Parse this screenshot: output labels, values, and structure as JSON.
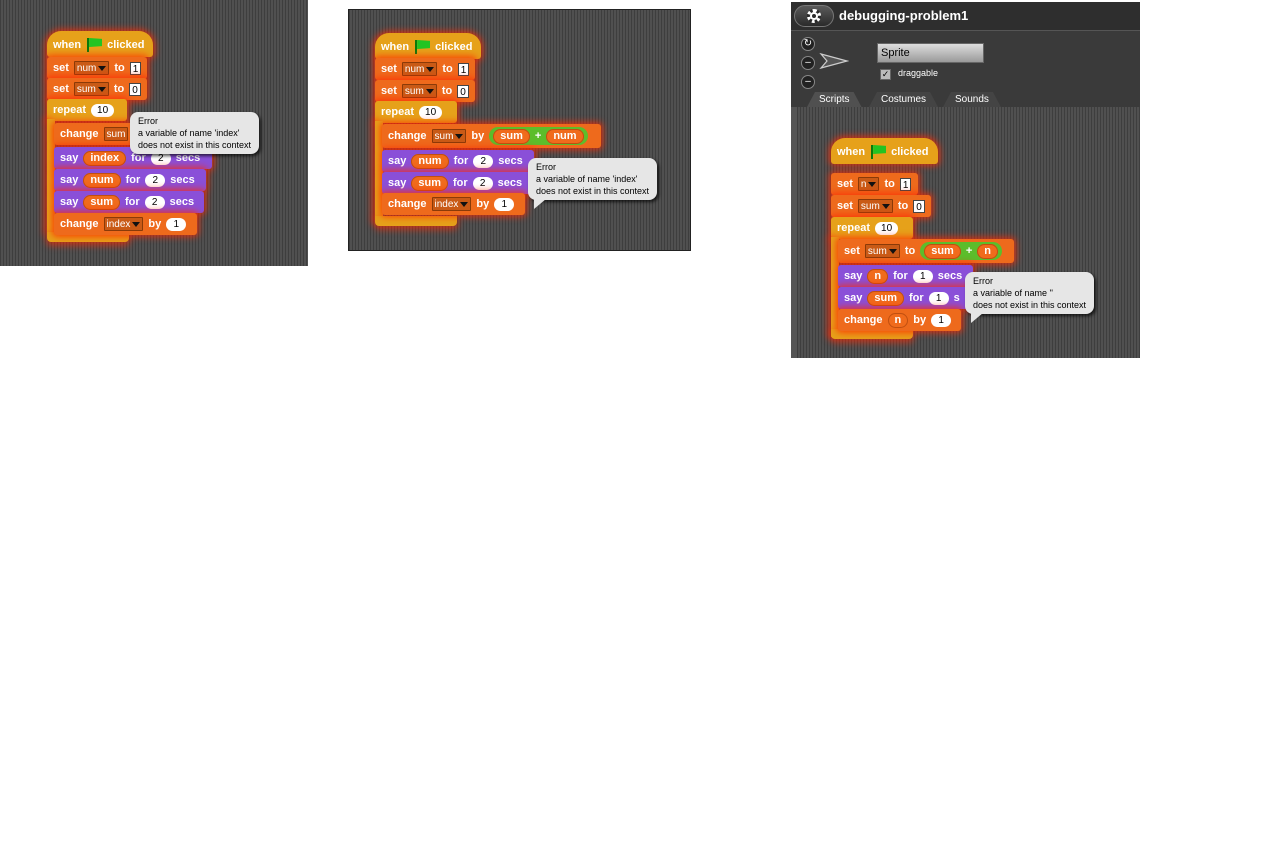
{
  "panel1": {
    "hat": {
      "when": "when",
      "clicked": "clicked"
    },
    "set1": {
      "label": "set",
      "var": "num",
      "to": "to",
      "value": "1"
    },
    "set2": {
      "label": "set",
      "var": "sum",
      "to": "to",
      "value": "0"
    },
    "repeat": {
      "label": "repeat",
      "count": "10"
    },
    "change1": {
      "label": "change",
      "var": "sum"
    },
    "say1": {
      "label": "say",
      "arg": "index",
      "for": "for",
      "secs_value": "2",
      "secs": "secs"
    },
    "say2": {
      "label": "say",
      "arg": "num",
      "for": "for",
      "secs_value": "2",
      "secs": "secs"
    },
    "say3": {
      "label": "say",
      "arg": "sum",
      "for": "for",
      "secs_value": "2",
      "secs": "secs"
    },
    "change2": {
      "label": "change",
      "var": "index",
      "by": "by",
      "value": "1"
    },
    "error": {
      "line1": "Error",
      "line2": "a variable of name 'index'",
      "line3": "does not exist in this context"
    }
  },
  "panel2": {
    "hat": {
      "when": "when",
      "clicked": "clicked"
    },
    "set1": {
      "label": "set",
      "var": "num",
      "to": "to",
      "value": "1"
    },
    "set2": {
      "label": "set",
      "var": "sum",
      "to": "to",
      "value": "0"
    },
    "repeat": {
      "label": "repeat",
      "count": "10"
    },
    "change1": {
      "label": "change",
      "var": "sum",
      "by": "by",
      "op_left": "sum",
      "op": "+",
      "op_right": "num"
    },
    "say1": {
      "label": "say",
      "arg": "num",
      "for": "for",
      "secs_value": "2",
      "secs": "secs"
    },
    "say2": {
      "label": "say",
      "arg": "sum",
      "for": "for",
      "secs_value": "2",
      "secs": "secs"
    },
    "change2": {
      "label": "change",
      "var": "index",
      "by": "by",
      "value": "1"
    },
    "error": {
      "line1": "Error",
      "line2": "a variable of name 'index'",
      "line3": "does not exist in this context"
    }
  },
  "panel3": {
    "title": "debugging-problem1",
    "sprite_name": "Sprite",
    "draggable_label": "draggable",
    "checkmark": "✓",
    "tabs": [
      "Scripts",
      "Costumes",
      "Sounds"
    ],
    "hat": {
      "when": "when",
      "clicked": "clicked"
    },
    "set1": {
      "label": "set",
      "var": "n",
      "to": "to",
      "value": "1"
    },
    "set2": {
      "label": "set",
      "var": "sum",
      "to": "to",
      "value": "0"
    },
    "repeat": {
      "label": "repeat",
      "count": "10"
    },
    "set3": {
      "label": "set",
      "var": "sum",
      "to": "to",
      "op_left": "sum",
      "op": "+",
      "op_right": "n"
    },
    "say1": {
      "label": "say",
      "arg": "n",
      "for": "for",
      "secs_value": "1",
      "secs": "secs"
    },
    "say2": {
      "label": "say",
      "arg": "sum",
      "for": "for",
      "secs_value": "1",
      "secs": "s"
    },
    "change1": {
      "label": "change",
      "var": "n",
      "by": "by",
      "value": "1"
    },
    "error": {
      "line1": "Error",
      "line2": "a variable of name ''",
      "line3": "does not exist in this context"
    }
  }
}
